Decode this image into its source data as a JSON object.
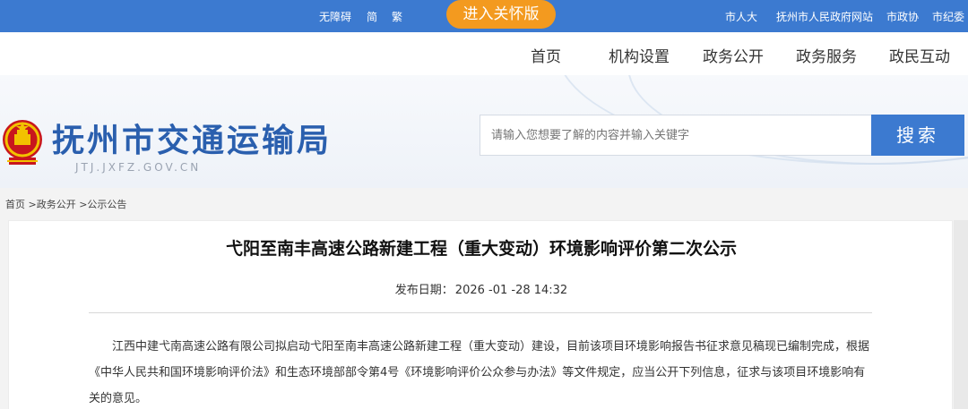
{
  "colors": {
    "brand_blue": "#3c7ad0",
    "care_orange": "#f39a1f",
    "title_blue": "#2a5fae"
  },
  "topbar": {
    "accessibility": "无障碍",
    "simplified": "简",
    "traditional": "繁",
    "care_mode": "进入关怀版",
    "links": [
      "市人大",
      "抚州市人民政府网站",
      "市政协",
      "市纪委"
    ]
  },
  "nav": {
    "items": [
      "首页",
      "机构设置",
      "政务公开",
      "政务服务",
      "政民互动"
    ]
  },
  "header": {
    "emblem_icon": "national-emblem-icon",
    "title": "抚州市交通运输局",
    "domain": "JTJ.JXFZ.GOV.CN"
  },
  "search": {
    "placeholder": "请输入您想要了解的内容并输入关键字",
    "button": "搜索"
  },
  "breadcrumb": [
    "首页",
    ">政务公开",
    ">公示公告"
  ],
  "article": {
    "title": "弋阳至南丰高速公路新建工程（重大变动）环境影响评价第二次公示",
    "publish_label": "发布日期：",
    "publish_date": "2026 -01 -28 14:32",
    "paragraph": "江西中建弋南高速公路有限公司拟启动弋阳至南丰高速公路新建工程（重大变动）建设，目前该项目环境影响报告书征求意见稿现已编制完成，根据《中华人民共和国环境影响评价法》和生态环境部部令第4号《环境影响评价公众参与办法》等文件规定，应当公开下列信息，征求与该项目环境影响有关的意见。"
  }
}
